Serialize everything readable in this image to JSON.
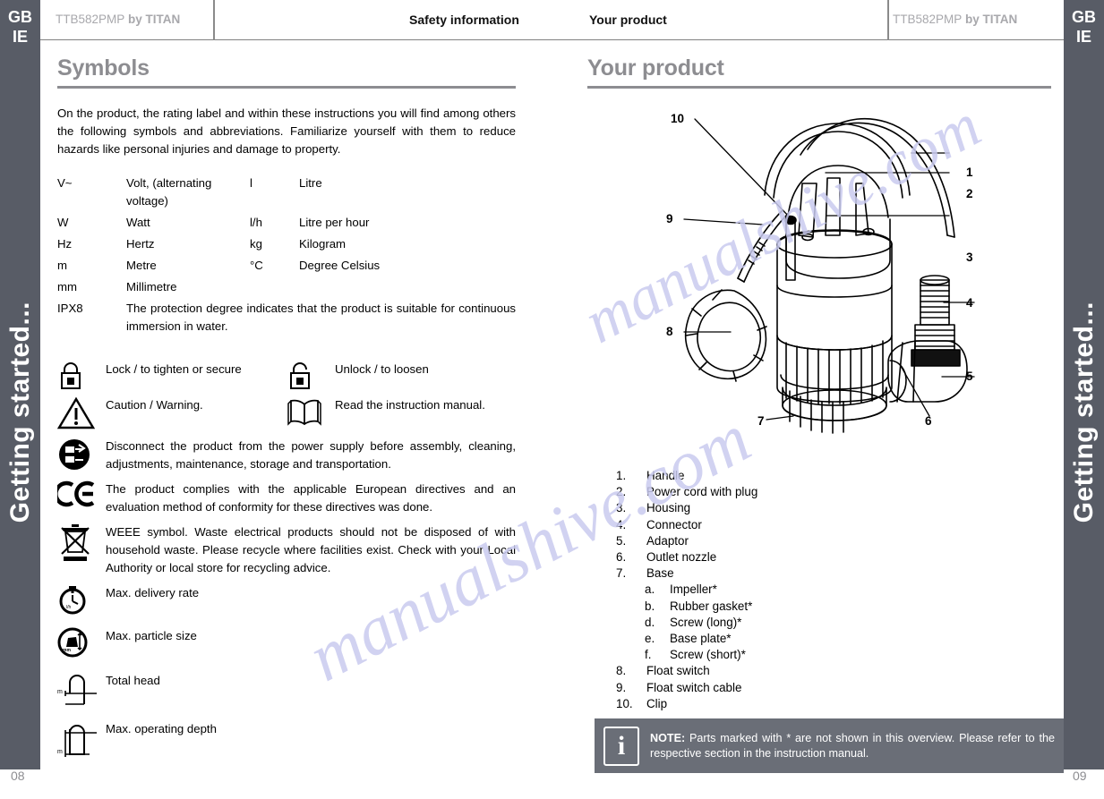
{
  "side_tabs": {
    "left": {
      "country": "GB\nIE",
      "country_line1": "GB",
      "country_line2": "IE",
      "chapter": "Getting started..."
    },
    "right": {
      "country_line1": "GB",
      "country_line2": "IE",
      "chapter": "Getting started..."
    }
  },
  "header": {
    "model_left": "TTB582PMP by TITAN",
    "model_left_plain": "TTB582PMP",
    "model_left_bold": " by TITAN",
    "section_left": "Safety information",
    "section_right": "Your product",
    "model_right_plain": "TTB582PMP",
    "model_right_bold": " by TITAN"
  },
  "left_page": {
    "title": "Symbols",
    "intro": "On the product, the rating label and within these instructions you will find among others the following symbols and abbreviations. Familiarize yourself with them to reduce hazards like personal injuries and damage to property.",
    "abbreviations": [
      {
        "sym_a": "V~",
        "def_a": "Volt, (alternating voltage)",
        "sym_b": "l",
        "def_b": "Litre"
      },
      {
        "sym_a": "W",
        "def_a": "Watt",
        "sym_b": "l/h",
        "def_b": "Litre per hour"
      },
      {
        "sym_a": "Hz",
        "def_a": "Hertz",
        "sym_b": "kg",
        "def_b": "Kilogram"
      },
      {
        "sym_a": "m",
        "def_a": "Metre",
        "sym_b": "°C",
        "def_b": "Degree Celsius"
      },
      {
        "sym_a": "mm",
        "def_a": "Millimetre",
        "sym_b": "",
        "def_b": ""
      }
    ],
    "ipx": {
      "code": "IPX8",
      "text": "The protection degree indicates that the product is suitable for continuous immersion in water."
    },
    "symbols": [
      {
        "icon": "lock-closed-icon",
        "text": "Lock / to tighten or secure",
        "pair_icon": "lock-open-icon",
        "pair_text": "Unlock / to loosen"
      },
      {
        "icon": "warning-triangle-icon",
        "text": "Caution / Warning.",
        "pair_icon": "read-manual-icon",
        "pair_text": "Read the instruction manual."
      },
      {
        "icon": "disconnect-plug-icon",
        "text": "Disconnect the product from the power supply before assembly, cleaning, adjustments, maintenance, storage and transportation."
      },
      {
        "icon": "ce-mark-icon",
        "text": "The product complies with the applicable European directives and an evaluation method of conformity for these directives was done."
      },
      {
        "icon": "weee-bin-icon",
        "text": "WEEE symbol. Waste electrical products should not be disposed of with household waste. Please recycle where facilities exist. Check with your Local Authority or local store for recycling advice."
      },
      {
        "icon": "delivery-rate-icon",
        "text": "Max. delivery rate"
      },
      {
        "icon": "particle-size-icon",
        "text": "Max. particle size"
      },
      {
        "icon": "total-head-icon",
        "text": "Total head"
      },
      {
        "icon": "operating-depth-icon",
        "text": "Max. operating depth"
      }
    ],
    "page_number": "08"
  },
  "right_page": {
    "title": "Your product",
    "figure_callouts": [
      "1",
      "2",
      "3",
      "4",
      "5",
      "6",
      "7",
      "8",
      "9",
      "10"
    ],
    "parts": [
      {
        "num": "1.",
        "label": "Handle"
      },
      {
        "num": "2.",
        "label": "Power cord with plug"
      },
      {
        "num": "3.",
        "label": "Housing"
      },
      {
        "num": "4.",
        "label": "Connector"
      },
      {
        "num": "5.",
        "label": "Adaptor"
      },
      {
        "num": "6.",
        "label": "Outlet nozzle"
      },
      {
        "num": "7.",
        "label": "Base",
        "sub": [
          {
            "num": "a.",
            "label": "Impeller*"
          },
          {
            "num": "b.",
            "label": "Rubber gasket*"
          },
          {
            "num": "d.",
            "label": "Screw (long)*"
          },
          {
            "num": "e.",
            "label": "Base plate*"
          },
          {
            "num": "f.",
            "label": "Screw (short)*"
          }
        ]
      },
      {
        "num": "8.",
        "label": "Float switch"
      },
      {
        "num": "9.",
        "label": "Float switch cable"
      },
      {
        "num": "10.",
        "label": "Clip"
      }
    ],
    "note": {
      "icon": "info-icon",
      "glyph": "i",
      "label": "NOTE:",
      "text": " Parts marked with * are not shown in this overview. Please refer to the respective section in the instruction manual."
    },
    "page_number": "09"
  },
  "watermark": {
    "text_1": "manualshive.com",
    "text_2": "manualshive.com",
    "color": "#c9cbef"
  },
  "colors": {
    "tab_bg": "#585c66",
    "heading_gray": "#8d8d91",
    "note_bg": "#6a6e77",
    "model_gray": "#a8a8ac"
  }
}
